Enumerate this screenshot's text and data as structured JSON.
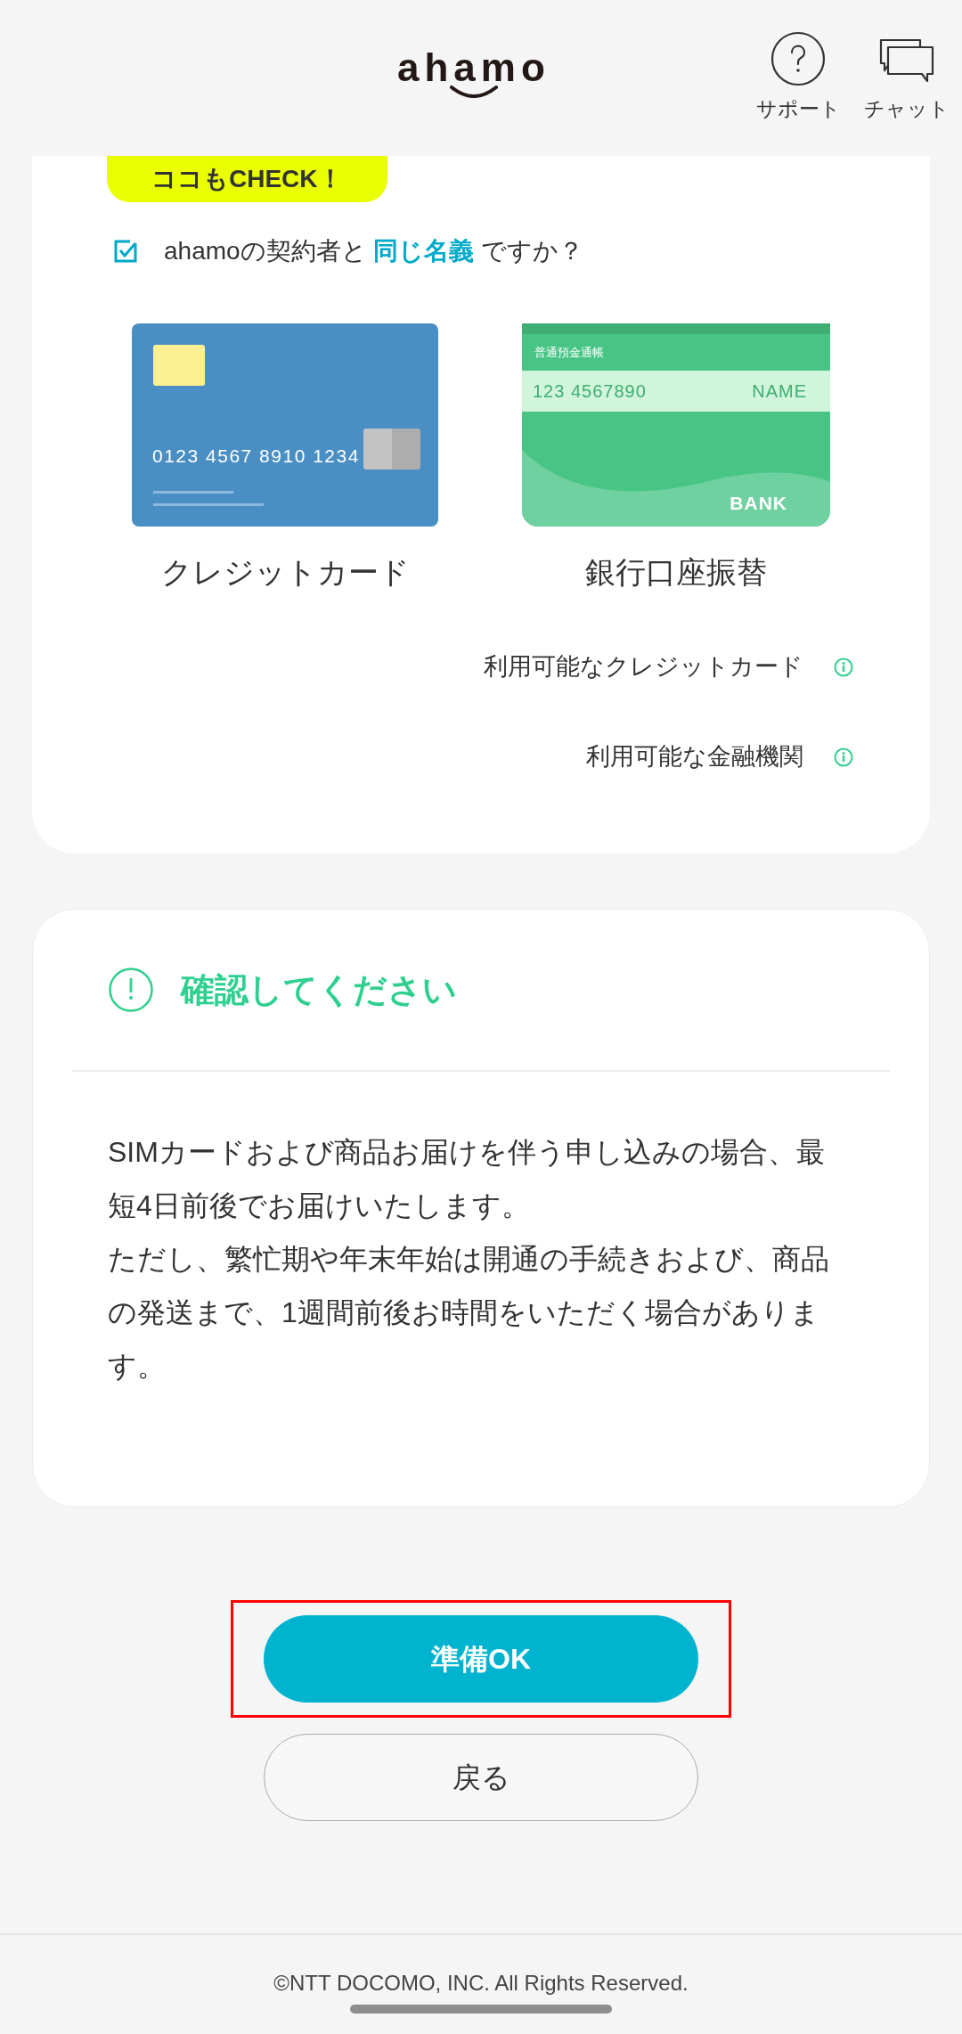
{
  "header": {
    "logo": "ahamo",
    "actions": [
      {
        "label": "サポート",
        "kind": "support"
      },
      {
        "label": "チャット",
        "kind": "chat"
      }
    ]
  },
  "check_card": {
    "badge": "ココもCHECK！",
    "checklist": [
      {
        "text": "ahamoの契約者と **同じ名義** ですか？",
        "checked": true
      }
    ],
    "payment_methods": [
      {
        "kind": "credit_card",
        "label": "クレジットカード",
        "card_number": "0123 4567 8910 1234"
      },
      {
        "kind": "bank_book",
        "label": "銀行口座振替",
        "book_title": "普通預金通帳",
        "account_number": "123 4567890",
        "name": "NAME",
        "bank": "BANK"
      }
    ],
    "links": [
      "利用可能なクレジットカード",
      "利用可能な金融機関"
    ]
  },
  "notice": {
    "title": "確認してください",
    "paragraphs": [
      "SIMカードおよび商品お届けを伴う申し込みの場合、最短4日前後でお届けいたします。",
      "ただし、繁忙期や年末年始は開通の手続きおよび、商品の発送まで、1週間前後お時間をいただく場合があります。"
    ]
  },
  "buttons": [
    {
      "label": "準備OK",
      "kind": "primary",
      "highlighted": true
    },
    {
      "label": "戻る",
      "kind": "secondary",
      "highlighted": false
    }
  ],
  "footer": "©NTT DOCOMO, INC. All Rights Reserved."
}
